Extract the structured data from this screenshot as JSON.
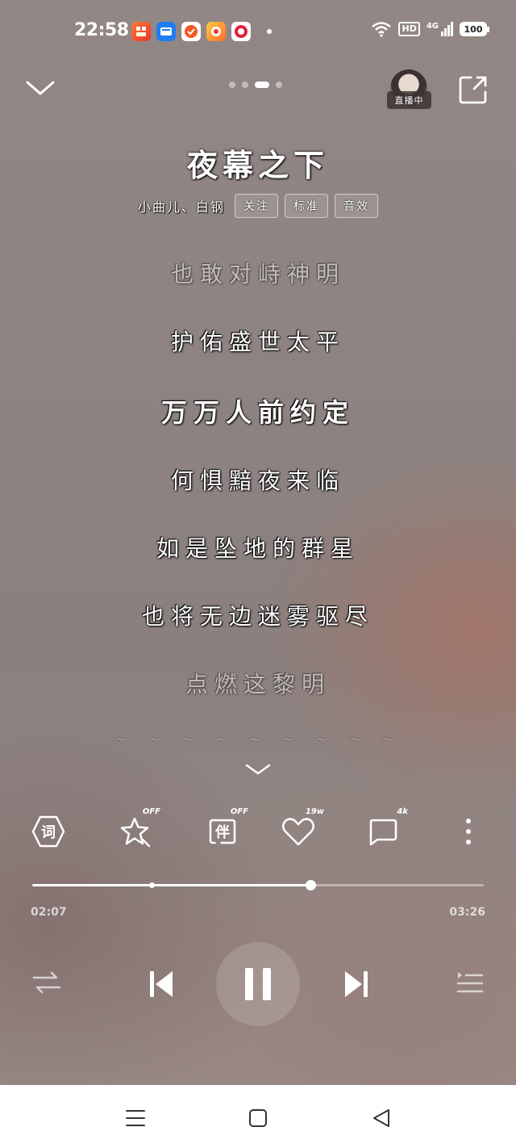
{
  "status_bar": {
    "time": "22:58",
    "network": "4G",
    "hd_label": "HD",
    "battery": "100",
    "notification_apps": [
      "app-1-icon",
      "app-2-icon",
      "app-3-icon",
      "app-4-icon",
      "app-5-icon"
    ]
  },
  "header": {
    "page_count": 4,
    "active_page": 3,
    "live_label": "直播中"
  },
  "song": {
    "title": "夜幕之下",
    "artists": "小曲儿、白钢",
    "tags": [
      "关注",
      "标准",
      "音效"
    ]
  },
  "lyrics": [
    {
      "text": "也敢对峙神明",
      "state": "dim"
    },
    {
      "text": "护佑盛世太平",
      "state": "normal"
    },
    {
      "text": "万万人前约定",
      "state": "current"
    },
    {
      "text": "何惧黯夜来临",
      "state": "normal"
    },
    {
      "text": "如是坠地的群星",
      "state": "normal"
    },
    {
      "text": "也将无边迷雾驱尽",
      "state": "normal"
    },
    {
      "text": "点燃这黎明",
      "state": "dim"
    }
  ],
  "actions": {
    "lyrics_label": "词",
    "star_badge": "OFF",
    "companion_label": "伴",
    "companion_badge": "OFF",
    "like_count": "19w",
    "comment_count": "4k"
  },
  "playback": {
    "current_time": "02:07",
    "total_time": "03:26",
    "progress_fraction": 0.616,
    "mark_fraction": 0.265,
    "state": "playing"
  },
  "colors": {
    "accent": "#ffffff",
    "background": "#8d8381"
  }
}
